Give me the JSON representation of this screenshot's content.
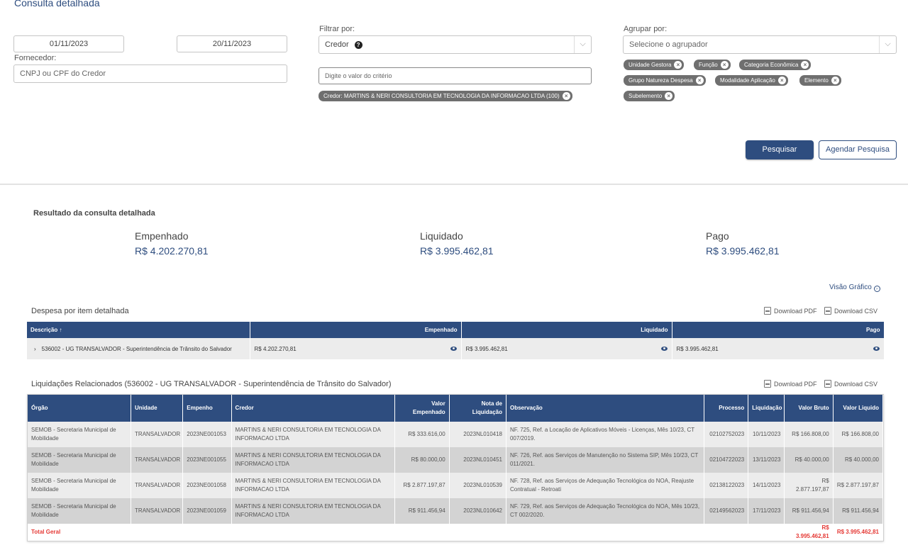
{
  "page_title": "Consulta detalhada",
  "filters": {
    "date_start": "01/11/2023",
    "date_end": "20/11/2023",
    "fornecedor_label": "Fornecedor:",
    "fornecedor_placeholder": "CNPJ ou CPF do Credor",
    "filtrar_label": "Filtrar por:",
    "filtrar_value": "Credor",
    "criterio_placeholder": "Digite o valor do critério",
    "credor_chip": "Credor: MARTINS & NERI CONSULTORIA EM TECNOLOGIA DA INFORMACAO LTDA (100)",
    "agrupar_label": "Agrupar por:",
    "agrupar_placeholder": "Selecione o agrupador",
    "agrupar_chips": [
      "Unidade Gestora",
      "Função",
      "Categoria Econômica",
      "Grupo Natureza Despesa",
      "Modalidade Aplicação",
      "Elemento",
      "Subelemento"
    ],
    "pesquisar_label": "Pesquisar",
    "agendar_label": "Agendar Pesquisa"
  },
  "results": {
    "title": "Resultado da consulta detalhada",
    "summary": [
      {
        "label": "Empenhado",
        "value": "R$ 4.202.270,81"
      },
      {
        "label": "Liquidado",
        "value": "R$ 3.995.462,81"
      },
      {
        "label": "Pago",
        "value": "R$ 3.995.462,81"
      }
    ],
    "visao_grafico": "Visão Gráfico",
    "download_pdf": "Download PDF",
    "download_csv": "Download CSV"
  },
  "despesa": {
    "title": "Despesa por item detalhada",
    "headers": {
      "descricao": "Descrição",
      "empenhado": "Empenhado",
      "liquidado": "Liquidado",
      "pago": "Pago"
    },
    "row": {
      "descricao": "536002 - UG TRANSALVADOR - Superintendência de Trânsito do Salvador",
      "empenhado": "R$ 4.202.270,81",
      "liquidado": "R$ 3.995.462,81",
      "pago": "R$ 3.995.462,81"
    }
  },
  "liquidacoes": {
    "title": "Liquidações Relacionados (536002 - UG TRANSALVADOR - Superintendência de Trânsito do Salvador)",
    "headers": {
      "orgao": "Órgão",
      "unidade": "Unidade",
      "empenho": "Empenho",
      "credor": "Credor",
      "valor_empenhado": "Valor Empenhado",
      "nota_liquidacao": "Nota de Liquidação",
      "observacao": "Observação",
      "processo": "Processo",
      "liquidacao": "Liquidação",
      "valor_bruto": "Valor Bruto",
      "valor_liquido": "Valor Liquido"
    },
    "rows": [
      {
        "orgao": "SEMOB - Secretaria Municipal de Mobilidade",
        "unidade": "TRANSALVADOR",
        "empenho": "2023NE001053",
        "credor": "MARTINS & NERI CONSULTORIA EM TECNOLOGIA DA INFORMACAO LTDA",
        "valor_empenhado": "R$ 333.616,00",
        "nota": "2023NL010418",
        "observacao": "NF. 725, Ref. a Locação de Aplicativos Móveis - Licenças, Mês 10/23, CT 007/2019.",
        "processo": "02102752023",
        "liquidacao": "10/11/2023",
        "valor_bruto": "R$ 166.808,00",
        "valor_liquido": "R$ 166.808,00"
      },
      {
        "orgao": "SEMOB - Secretaria Municipal de Mobilidade",
        "unidade": "TRANSALVADOR",
        "empenho": "2023NE001055",
        "credor": "MARTINS & NERI CONSULTORIA EM TECNOLOGIA DA INFORMACAO LTDA",
        "valor_empenhado": "R$ 80.000,00",
        "nota": "2023NL010451",
        "observacao": "NF. 726, Ref. aos Serviços de Manutenção no Sistema SIP, Mês 10/23, CT 011/2021.",
        "processo": "02104722023",
        "liquidacao": "13/11/2023",
        "valor_bruto": "R$ 40.000,00",
        "valor_liquido": "R$ 40.000,00"
      },
      {
        "orgao": "SEMOB - Secretaria Municipal de Mobilidade",
        "unidade": "TRANSALVADOR",
        "empenho": "2023NE001058",
        "credor": "MARTINS & NERI CONSULTORIA EM TECNOLOGIA DA INFORMACAO LTDA",
        "valor_empenhado": "R$ 2.877.197,87",
        "nota": "2023NL010539",
        "observacao": "NF. 728, Ref. aos Serviços de Adequação Tecnológica do NOA, Reajuste Contratual - Retroati",
        "processo": "02138122023",
        "liquidacao": "14/11/2023",
        "valor_bruto": "R$ 2.877.197,87",
        "valor_liquido": "R$ 2.877.197,87"
      },
      {
        "orgao": "SEMOB - Secretaria Municipal de Mobilidade",
        "unidade": "TRANSALVADOR",
        "empenho": "2023NE001059",
        "credor": "MARTINS & NERI CONSULTORIA EM TECNOLOGIA DA INFORMACAO LTDA",
        "valor_empenhado": "R$ 911.456,94",
        "nota": "2023NL010642",
        "observacao": "NF. 729, Ref. aos Serviços de Adequação Tecnológica do NOA, Mês 10/23, CT 002/2020.",
        "processo": "02149562023",
        "liquidacao": "17/11/2023",
        "valor_bruto": "R$ 911.456,94",
        "valor_liquido": "R$ 911.456,94"
      }
    ],
    "total_label": "Total Geral",
    "total_bruto": "R$ 3.995.462,81",
    "total_liquido": "R$ 3.995.462,81"
  }
}
